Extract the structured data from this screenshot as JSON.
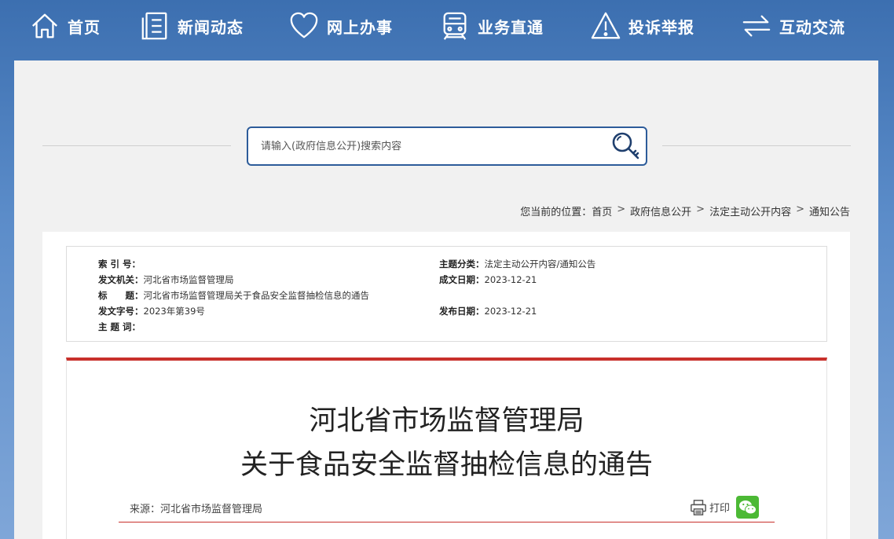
{
  "nav": {
    "items": [
      {
        "label": "首页",
        "icon": "home-icon"
      },
      {
        "label": "新闻动态",
        "icon": "news-icon"
      },
      {
        "label": "网上办事",
        "icon": "heart-icon"
      },
      {
        "label": "业务直通",
        "icon": "train-icon"
      },
      {
        "label": "投诉举报",
        "icon": "warning-icon"
      },
      {
        "label": "互动交流",
        "icon": "exchange-icon"
      }
    ]
  },
  "search": {
    "placeholder": "请输入(政府信息公开)搜索内容"
  },
  "breadcrumb": {
    "prefix": "您当前的位置：",
    "items": [
      "首页",
      "政府信息公开",
      "法定主动公开内容",
      "通知公告"
    ],
    "separator": ">"
  },
  "meta": {
    "index_label": "索 引 号：",
    "index_value": "",
    "category_label": "主题分类：",
    "category_value": "法定主动公开内容/通知公告",
    "issuer_label": "发文机关：",
    "issuer_value": "河北省市场监督管理局",
    "created_label": "成文日期：",
    "created_value": "2023-12-21",
    "title_label": "标　　题：",
    "title_value": "河北省市场监督管理局关于食品安全监督抽检信息的通告",
    "docno_label": "发文字号：",
    "docno_value": "2023年第39号",
    "published_label": "发布日期：",
    "published_value": "2023-12-21",
    "keywords_label": "主 题 词：",
    "keywords_value": ""
  },
  "article": {
    "title_line1": "河北省市场监督管理局",
    "title_line2": "关于食品安全监督抽检信息的通告",
    "source": "来源：河北省市场监督管理局",
    "print_label": "打印"
  },
  "colors": {
    "accent_red": "#c8302b",
    "brand_blue": "#2d5c9a",
    "wechat_green": "#4cb935"
  }
}
